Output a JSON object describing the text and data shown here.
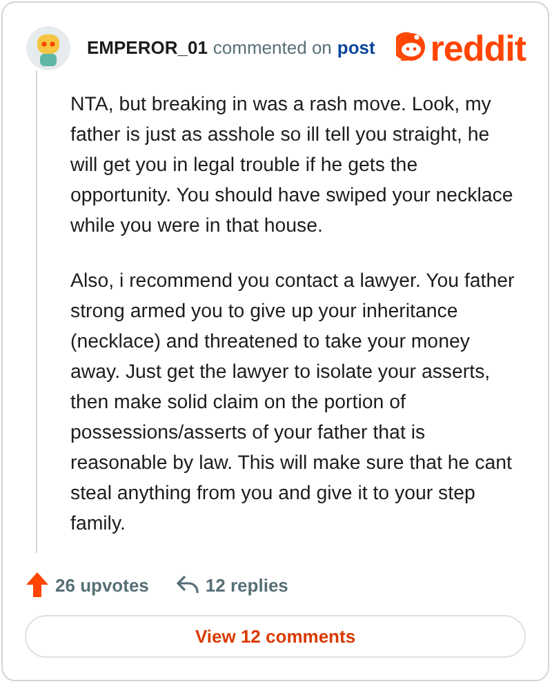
{
  "header": {
    "username": "EMPEROR_01",
    "action": "commented on",
    "link": "post",
    "logo_text": "reddit"
  },
  "comment": {
    "paragraphs": [
      "NTA, but breaking in was a rash move. Look, my father is just as asshole so ill tell you straight, he will get you in legal trouble if he gets the opportunity. You should have swiped your necklace while you were in that house.",
      "Also, i recommend you contact a lawyer. You father strong armed you to give up your inheritance (necklace) and threatened to take your money away. Just get the lawyer to isolate your asserts, then make solid claim on the portion of possessions/asserts of your father that is reasonable by law. This will make sure that he cant steal anything from you and give it to your step family."
    ]
  },
  "footer": {
    "upvotes": "26 upvotes",
    "replies": "12 replies",
    "button": "View 12 comments"
  }
}
